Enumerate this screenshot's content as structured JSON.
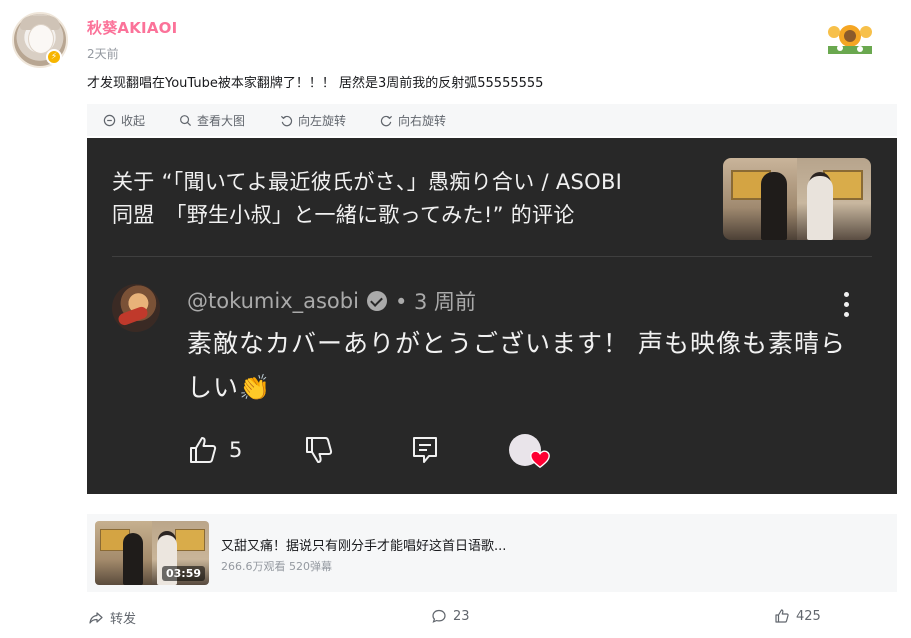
{
  "post": {
    "username": "秋葵AKIAOI",
    "time": "2天前",
    "text": "才发现翻唱在YouTube被本家翻牌了！！！ 居然是3周前我的反射弧55555555"
  },
  "image_toolbar": {
    "collapse": "收起",
    "view_large": "查看大图",
    "rotate_left": "向左旋转",
    "rotate_right": "向右旋转"
  },
  "youtube": {
    "title_line1": "关于 “「聞いてよ最近彼氏がさ、」愚痴り合い / ASOBI",
    "title_line2": "同盟　「野生小叔」と一緒に歌ってみた!” 的评论",
    "handle": "@tokumix_asobi",
    "time": "• 3 周前",
    "comment": "素敵なカバーありがとうございます！ 声も映像も素晴らしい👏",
    "likes": "5"
  },
  "video_card": {
    "duration": "03:59",
    "title": "又甜又痛！据说只有刚分手才能唱好这首日语歌...",
    "stats": "266.6万观看 520弹幕"
  },
  "footer": {
    "share": "转发",
    "comments": "23",
    "likes": "425"
  },
  "colors": {
    "username": "#fb7299",
    "dark_bg": "#282828",
    "heart": "#ff0033"
  }
}
